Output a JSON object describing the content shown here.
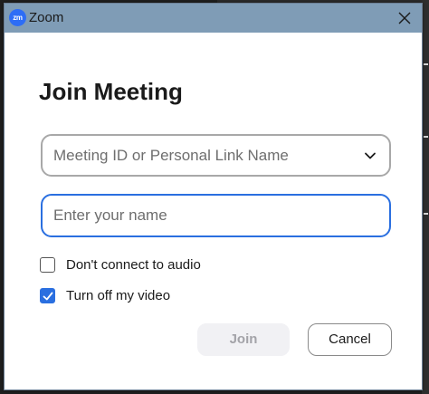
{
  "window": {
    "app_logo_text": "zm",
    "title": "Zoom"
  },
  "dialog": {
    "heading": "Join Meeting",
    "meeting_id": {
      "placeholder": "Meeting ID or Personal Link Name",
      "value": ""
    },
    "name_field": {
      "placeholder": "Enter your name",
      "value": ""
    },
    "options": [
      {
        "label": "Don't connect to audio",
        "checked": false
      },
      {
        "label": "Turn off my video",
        "checked": true
      }
    ],
    "join_label": "Join",
    "join_enabled": false,
    "cancel_label": "Cancel"
  },
  "icons": {
    "close": "close-icon",
    "dropdown": "chevron-down-icon",
    "check": "checkmark-icon"
  },
  "colors": {
    "titlebar": "#7f9cb6",
    "accent": "#2a6fe0",
    "logo": "#2d6df6",
    "disabled_button_bg": "#f1f1f4",
    "disabled_button_text": "#a3a3a8"
  }
}
